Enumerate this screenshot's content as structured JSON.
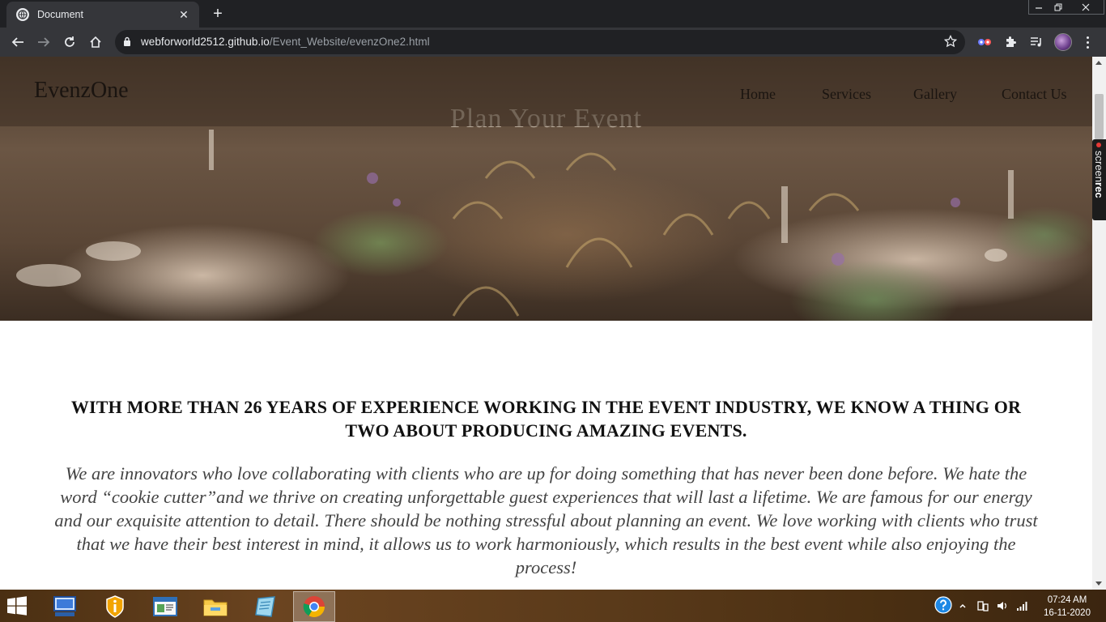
{
  "browser": {
    "tab_title": "Document",
    "url_host": "webforworld2512.github.io",
    "url_path": "/Event_Website/evenzOne2.html"
  },
  "site": {
    "logo": "EvenzOne",
    "nav": [
      "Home",
      "Services",
      "Gallery",
      "Contact Us"
    ],
    "hero_heading": "Plan Your Event"
  },
  "content": {
    "headline": "With more than 26 years of experience working in the event industry, we know a thing or two about producing amazing events.",
    "paragraph": "We are innovators who love collaborating with clients who are up for doing something that has never been done before. We hate the word “cookie cutter”and we thrive on creating unforgettable guest experiences that will last a lifetime. We are famous for our energy and our exquisite attention to detail. There should be nothing stressful about planning an event. We love working with clients who trust that we have their best interest in mind, it allows us to work harmoniously, which results in the best event while also enjoying the process!"
  },
  "overlay": {
    "screenrec_light": "screen",
    "screenrec_bold": "rec"
  },
  "taskbar": {
    "time": "07:24 AM",
    "date": "16-11-2020"
  },
  "colors": {
    "chrome_dark": "#202124",
    "chrome_toolbar": "#35363a",
    "taskbar_brown": "#5a3a1a"
  }
}
